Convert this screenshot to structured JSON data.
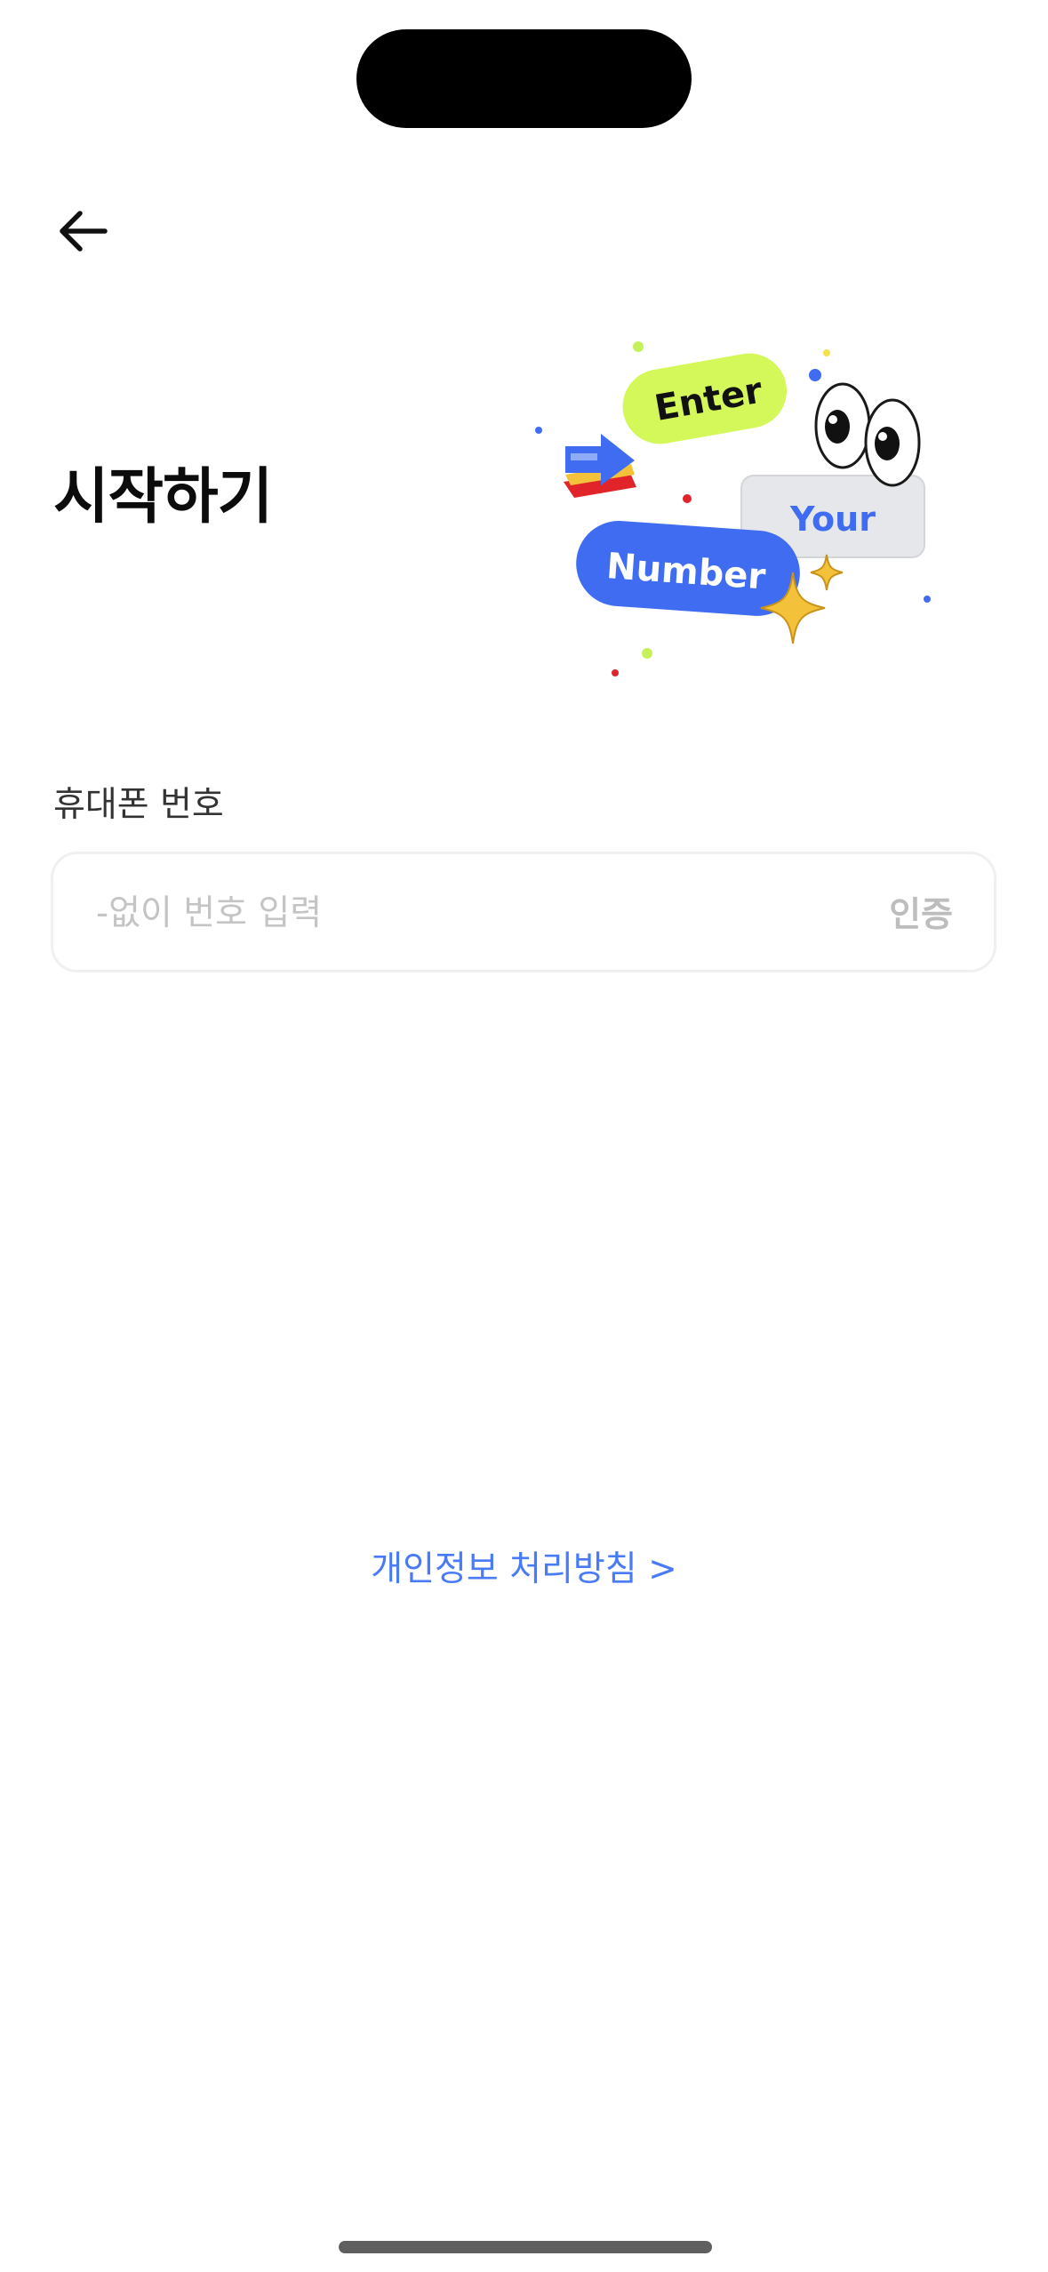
{
  "header": {
    "back_icon": "arrow-left-icon"
  },
  "title": "시작하기",
  "illustration": {
    "word1": "Enter",
    "word2": "Your",
    "word3": "Number",
    "colors": {
      "lime": "#d4f75a",
      "blue": "#3f6cf0",
      "gray": "#e6e7ea",
      "gold": "#f3c23a",
      "red": "#e0242a"
    }
  },
  "phone": {
    "label": "휴대폰 번호",
    "placeholder": "-없이 번호 입력",
    "value": "",
    "verify_label": "인증"
  },
  "footer": {
    "privacy_link": "개인정보 처리방침 >"
  },
  "colors": {
    "accent": "#4a7bf7",
    "title": "#0c0c0c",
    "placeholder": "#c4c4c4",
    "border": "#f0f0f0"
  }
}
